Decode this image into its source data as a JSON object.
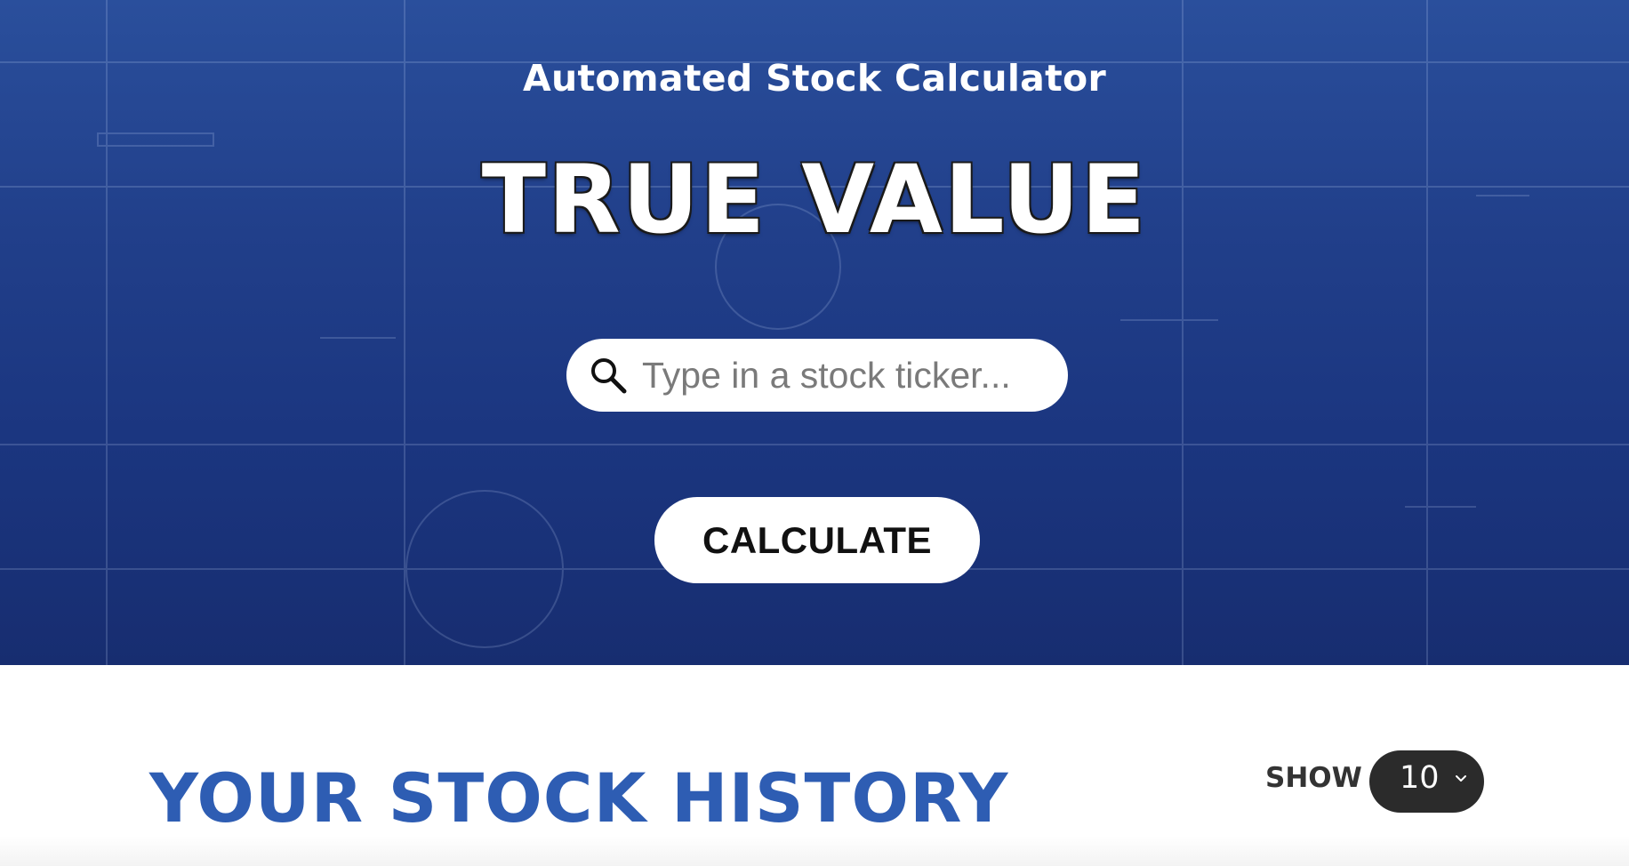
{
  "hero": {
    "subtitle": "Automated Stock Calculator",
    "title": "TRUE VALUE",
    "search": {
      "placeholder": "Type in a stock ticker...",
      "value": "",
      "icon": "search-icon"
    },
    "calculate_label": "CALCULATE"
  },
  "history": {
    "title": "YOUR STOCK HISTORY",
    "show_label": "SHOW",
    "show_value": "10"
  },
  "colors": {
    "hero_background": "#213f8a",
    "history_title": "#2e5db3",
    "select_background": "#2b2b2b",
    "button_background": "#ffffff"
  }
}
